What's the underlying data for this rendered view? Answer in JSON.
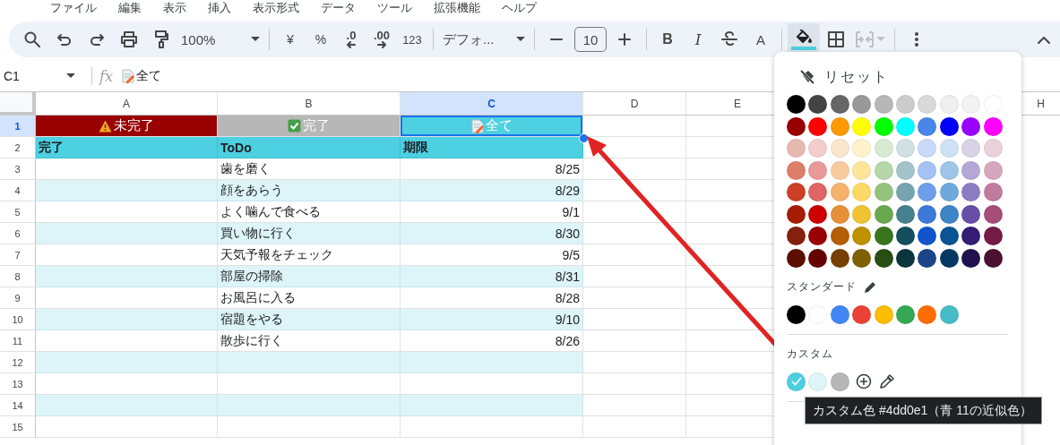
{
  "menu": [
    "ファイル",
    "編集",
    "表示",
    "挿入",
    "表示形式",
    "データ",
    "ツール",
    "拡張機能",
    "ヘルプ"
  ],
  "toolbar": {
    "zoom": "100%",
    "currency": "¥",
    "percent": "%",
    "decimal_decrease": ".0",
    "decimal_increase": ".00",
    "number_formats": "123",
    "font": "デフォ...",
    "font_size": "10",
    "bold": "B",
    "italic": "I",
    "text_color": "A",
    "fill_color": {
      "selected": true,
      "color": "#4dd0e1"
    },
    "merge": {
      "disabled": true
    }
  },
  "formula_bar": {
    "cell_ref": "C1",
    "fx": "fx",
    "formula": "全て"
  },
  "sheet": {
    "columns": [
      {
        "label": "A",
        "selected": false
      },
      {
        "label": "B",
        "selected": false
      },
      {
        "label": "C",
        "selected": true
      },
      {
        "label": "D",
        "selected": false
      },
      {
        "label": "E",
        "selected": false
      },
      {
        "label": "H",
        "selected": false
      }
    ],
    "rows": [
      {
        "number": "1",
        "selected": true,
        "kind": "filter",
        "cells": [
          {
            "text": "未完了",
            "kind": "warning",
            "color": "#990000"
          },
          {
            "text": "完了",
            "kind": "check",
            "color": "#b7b7b7"
          },
          {
            "text": "全て",
            "kind": "memo",
            "color": "#4dd0e1"
          }
        ]
      },
      {
        "number": "2",
        "selected": false,
        "kind": "header",
        "cells": [
          {
            "text": "完了"
          },
          {
            "text": "ToDo"
          },
          {
            "text": "期限"
          }
        ]
      },
      {
        "number": "3",
        "selected": false,
        "kind": "item",
        "todo": "歯を磨く",
        "due": "8/25"
      },
      {
        "number": "4",
        "selected": false,
        "kind": "item",
        "todo": "顔をあらう",
        "due": "8/29"
      },
      {
        "number": "5",
        "selected": false,
        "kind": "item",
        "todo": "よく噛んで食べる",
        "due": "9/1"
      },
      {
        "number": "6",
        "selected": false,
        "kind": "item",
        "todo": "買い物に行く",
        "due": "8/30"
      },
      {
        "number": "7",
        "selected": false,
        "kind": "item",
        "todo": "天気予報をチェック",
        "due": "9/5"
      },
      {
        "number": "8",
        "selected": false,
        "kind": "item",
        "todo": "部屋の掃除",
        "due": "8/31"
      },
      {
        "number": "9",
        "selected": false,
        "kind": "item",
        "todo": "お風呂に入る",
        "due": "8/28"
      },
      {
        "number": "10",
        "selected": false,
        "kind": "item",
        "todo": "宿題をやる",
        "due": "9/10"
      },
      {
        "number": "11",
        "selected": false,
        "kind": "item",
        "todo": "散歩に行く",
        "due": "8/26"
      },
      {
        "number": "12",
        "selected": false,
        "kind": "item"
      },
      {
        "number": "13",
        "selected": false,
        "kind": "item"
      },
      {
        "number": "14",
        "selected": false,
        "kind": "item"
      },
      {
        "number": "15",
        "selected": false,
        "kind": "item"
      }
    ]
  },
  "color_panel": {
    "reset": "リセット",
    "palette": [
      {
        "color": "#000000"
      },
      {
        "color": "#434343"
      },
      {
        "color": "#666666"
      },
      {
        "color": "#999999"
      },
      {
        "color": "#b7b7b7"
      },
      {
        "color": "#cccccc"
      },
      {
        "color": "#d9d9d9"
      },
      {
        "color": "#efefef"
      },
      {
        "color": "#f3f3f3"
      },
      {
        "color": "#ffffff"
      },
      {
        "color": "#980000"
      },
      {
        "color": "#ff0000"
      },
      {
        "color": "#ff9900"
      },
      {
        "color": "#ffff00"
      },
      {
        "color": "#00ff00"
      },
      {
        "color": "#00ffff"
      },
      {
        "color": "#4a86e8"
      },
      {
        "color": "#0000ff"
      },
      {
        "color": "#9900ff"
      },
      {
        "color": "#ff00ff"
      },
      {
        "color": "#e6b8af"
      },
      {
        "color": "#f4cccc"
      },
      {
        "color": "#fce5cd"
      },
      {
        "color": "#fff2cc"
      },
      {
        "color": "#d9ead3"
      },
      {
        "color": "#d0e0e3"
      },
      {
        "color": "#c9daf8"
      },
      {
        "color": "#cfe2f3"
      },
      {
        "color": "#d9d2e9"
      },
      {
        "color": "#ead1dc"
      },
      {
        "color": "#dd7e6b"
      },
      {
        "color": "#ea9999"
      },
      {
        "color": "#f9cb9c"
      },
      {
        "color": "#ffe599"
      },
      {
        "color": "#b6d7a8"
      },
      {
        "color": "#a2c4c9"
      },
      {
        "color": "#a4c2f4"
      },
      {
        "color": "#9fc5e8"
      },
      {
        "color": "#b4a7d6"
      },
      {
        "color": "#d5a6bd"
      },
      {
        "color": "#cc4125"
      },
      {
        "color": "#e06666"
      },
      {
        "color": "#f6b26b"
      },
      {
        "color": "#ffd966"
      },
      {
        "color": "#93c47d"
      },
      {
        "color": "#76a5af"
      },
      {
        "color": "#6d9eeb"
      },
      {
        "color": "#6fa8dc"
      },
      {
        "color": "#8e7cc3"
      },
      {
        "color": "#c27ba0"
      },
      {
        "color": "#a61c00"
      },
      {
        "color": "#cc0000"
      },
      {
        "color": "#e69138"
      },
      {
        "color": "#f1c232"
      },
      {
        "color": "#6aa84f"
      },
      {
        "color": "#45818e"
      },
      {
        "color": "#3c78d8"
      },
      {
        "color": "#3d85c6"
      },
      {
        "color": "#674ea7"
      },
      {
        "color": "#a64d79"
      },
      {
        "color": "#85200c"
      },
      {
        "color": "#990000"
      },
      {
        "color": "#b45f06"
      },
      {
        "color": "#bf9000"
      },
      {
        "color": "#38761d"
      },
      {
        "color": "#134f5c"
      },
      {
        "color": "#1155cc"
      },
      {
        "color": "#0b5394"
      },
      {
        "color": "#351c75"
      },
      {
        "color": "#741b47"
      },
      {
        "color": "#5b0f00"
      },
      {
        "color": "#660000"
      },
      {
        "color": "#783f04"
      },
      {
        "color": "#7f6000"
      },
      {
        "color": "#274e13"
      },
      {
        "color": "#0c343d"
      },
      {
        "color": "#1c4587"
      },
      {
        "color": "#073763"
      },
      {
        "color": "#20124d"
      },
      {
        "color": "#4c1130"
      }
    ],
    "standard_label": "スタンダード",
    "standard": [
      {
        "color": "#000000"
      },
      {
        "color": "#ffffff"
      },
      {
        "color": "#4285f4"
      },
      {
        "color": "#ea4335"
      },
      {
        "color": "#fbbc04"
      },
      {
        "color": "#34a853"
      },
      {
        "color": "#ff6d01"
      },
      {
        "color": "#46bdc6"
      }
    ],
    "custom_label": "カスタム",
    "custom": [
      {
        "color": "#4dd0e1",
        "selected": true
      },
      {
        "color": "#ddf4f8",
        "selected": false
      },
      {
        "color": "#b7b7b7",
        "selected": false
      }
    ],
    "tooltip": "カスタム色 #4dd0e1（青 11の近似色）"
  }
}
